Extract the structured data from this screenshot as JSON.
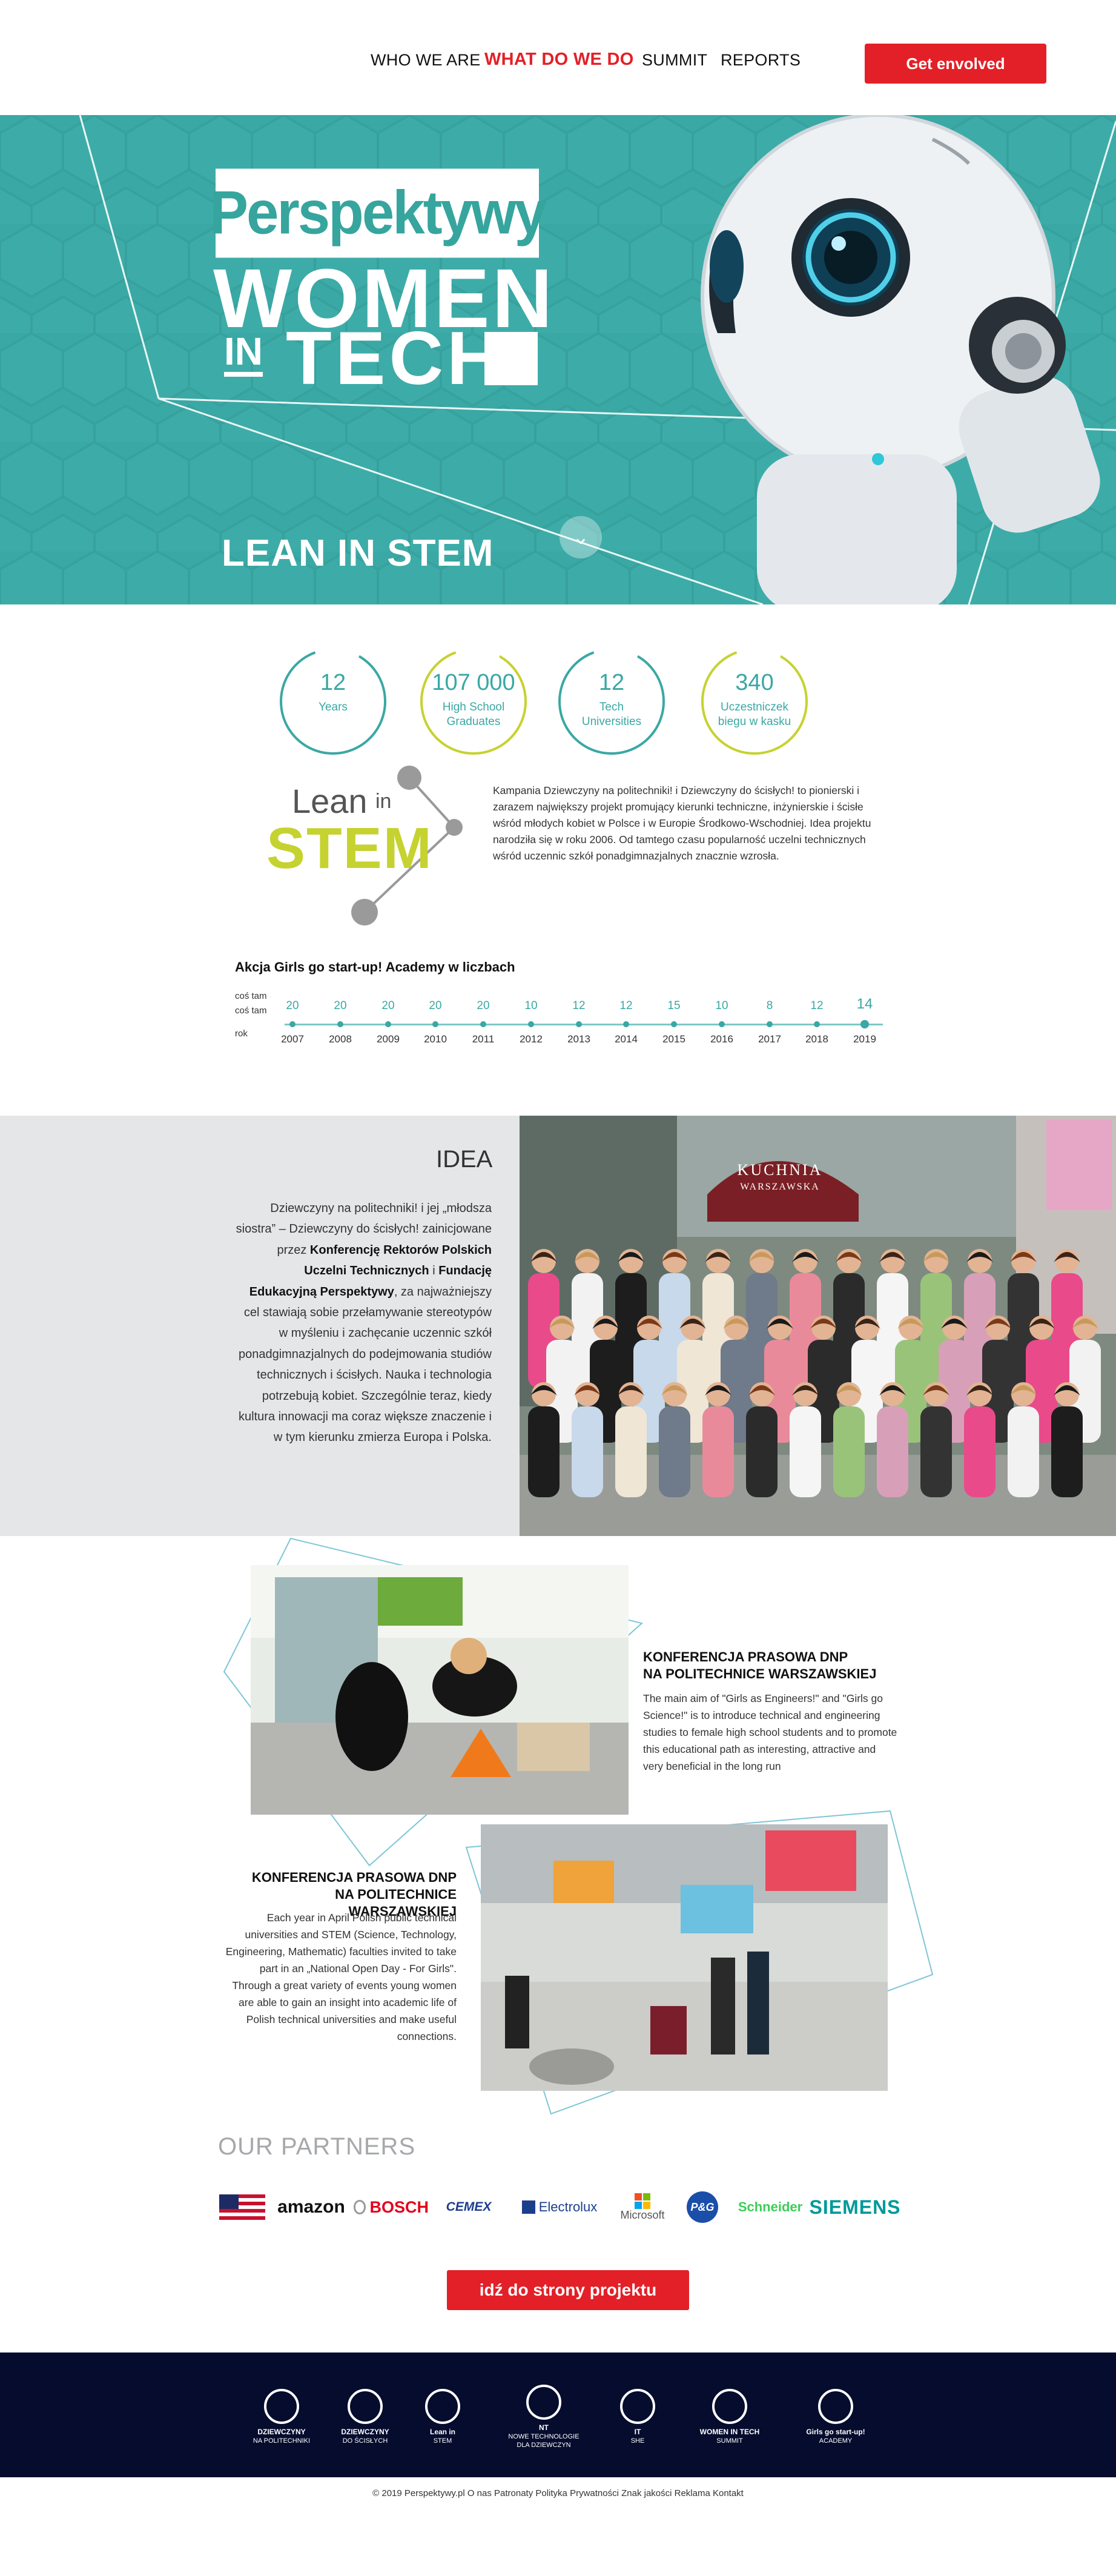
{
  "header": {
    "nav": [
      {
        "label": "WHO WE ARE",
        "active": false
      },
      {
        "label": "WHAT DO WE DO",
        "active": true
      },
      {
        "label": "SUMMIT",
        "active": false
      },
      {
        "label": "REPORTS",
        "active": false
      }
    ],
    "cta_label": "Get envolved",
    "accent_color": "#e32027"
  },
  "hero": {
    "logo_top": "Perspektywy",
    "logo_women": "WOMEN",
    "logo_in": "IN",
    "logo_tech": "TECH",
    "title": "LEAN IN STEM",
    "background_color": "#3aa8a4",
    "scroll_icon": "chevron-down-icon"
  },
  "stats": [
    {
      "value": "12",
      "label": "Years",
      "color": "#3aa8a4"
    },
    {
      "value": "107 000",
      "label": "High School Graduates",
      "color": "#c6d230"
    },
    {
      "value": "12",
      "label": "Tech Universities",
      "color": "#3aa8a4"
    },
    {
      "value": "340",
      "label": "Uczestniczek biegu w kasku",
      "color": "#c6d230"
    }
  ],
  "lean_in_stem": {
    "logo_lean": "Lean",
    "logo_in": "in",
    "logo_stem": "STEM",
    "text": "Kampania Dziewczyny na politechniki! i Dziewczyny do ścisłych! to pionierski i zarazem największy projekt promujący kierunki techniczne, inżynierskie i ścisłe wśród młodych kobiet w Polsce i w Europie Środkowo-Wschodniej. Idea projektu narodziła się w roku 2006. Od tamtego czasu popularność uczelni technicznych wśród uczennic szkół ponadgimnazjalnych znacznie wzrosła."
  },
  "timeline": {
    "title": "Akcja Girls go start-up! Academy w liczbach",
    "row_labels": [
      "coś tam",
      "coś tam",
      "rok"
    ],
    "points": [
      {
        "year": "2007",
        "value": "20"
      },
      {
        "year": "2008",
        "value": "20"
      },
      {
        "year": "2009",
        "value": "20"
      },
      {
        "year": "2010",
        "value": "20"
      },
      {
        "year": "2011",
        "value": "20"
      },
      {
        "year": "2012",
        "value": "10"
      },
      {
        "year": "2013",
        "value": "12"
      },
      {
        "year": "2014",
        "value": "12"
      },
      {
        "year": "2015",
        "value": "15"
      },
      {
        "year": "2016",
        "value": "10"
      },
      {
        "year": "2017",
        "value": "8"
      },
      {
        "year": "2018",
        "value": "12"
      },
      {
        "year": "2019",
        "value": "14"
      }
    ]
  },
  "idea": {
    "title": "IDEA",
    "text_1": "Dziewczyny na politechniki! i jej „młodsza siostra” – Dziewczyny do ścisłych! zainicjowane przez ",
    "bold_1": "Konferencję Rektorów Polskich Uczelni Technicznych",
    "text_2": " i ",
    "bold_2": "Fundację Edukacyjną Perspektywy",
    "text_3": ", za najważniejszy cel stawiają sobie przełamywanie stereotypów w myśleniu i zachęcanie uczennic szkół ponadgimnazjalnych do podejmowania studiów technicznych i ścisłych. Nauka i technologia potrzebują kobiet. Szczególnie teraz, kiedy kultura innowacji ma coraz większe znaczenie i w tym kierunku zmierza Europa i Polska.",
    "photo_sign_1": "KUCHNIA",
    "photo_sign_2": "WARSZAWSKA"
  },
  "conference": [
    {
      "title_1": "KONFERENCJA PRASOWA DNP",
      "title_2": "NA POLITECHNICE WARSZAWSKIEJ",
      "text": "The main aim of \"Girls as Engineers!\" and \"Girls go Science!\" is to introduce technical and engineering studies to female high school students and to promote this educational path as interesting, attractive and very beneficial in the long run"
    },
    {
      "title_1": "KONFERENCJA PRASOWA DNP",
      "title_2": "NA POLITECHNICE WARSZAWSKIEJ",
      "text": "Each year in April Polish public technical universities and STEM (Science, Technology, Engineering, Mathematic) faculties invited to take part in an „National Open Day - For Girls\". Through a great variety of events young women are able to gain an insight into academic life of Polish technical universities and make useful connections."
    }
  ],
  "partners": {
    "title": "OUR PARTNERS",
    "items": [
      {
        "name": "usa-flag-icon",
        "label": ""
      },
      {
        "name": "amazon-logo",
        "label": "amazon"
      },
      {
        "name": "bosch-logo",
        "label": "BOSCH"
      },
      {
        "name": "cemex-logo",
        "label": "CEMEX"
      },
      {
        "name": "electrolux-logo",
        "label": "Electrolux"
      },
      {
        "name": "microsoft-logo",
        "label": "Microsoft"
      },
      {
        "name": "pg-logo",
        "label": "P&G"
      },
      {
        "name": "schneider-logo",
        "label": "Schneider"
      },
      {
        "name": "siemens-logo",
        "label": "SIEMENS"
      }
    ],
    "button_label": "idź do strony projektu"
  },
  "footer": {
    "logos": [
      {
        "line1": "DZIEWCZYNY",
        "line2": "NA POLITECHNIKI"
      },
      {
        "line1": "DZIEWCZYNY",
        "line2": "DO ŚCISŁYCH"
      },
      {
        "line1": "Lean in",
        "line2": "STEM"
      },
      {
        "line1": "NT",
        "line2": "NOWE TECHNOLOGIE DLA DZIEWCZYN"
      },
      {
        "line1": "IT",
        "line2": "SHE"
      },
      {
        "line1": "WOMEN IN TECH",
        "line2": "SUMMIT"
      },
      {
        "line1": "Girls go start-up!",
        "line2": "ACADEMY"
      }
    ],
    "copyright": "© 2019 Perspektywy.pl O nas Patronaty Polityka Prywatności Znak jakości Reklama Kontakt",
    "background_color": "#050c2d"
  }
}
